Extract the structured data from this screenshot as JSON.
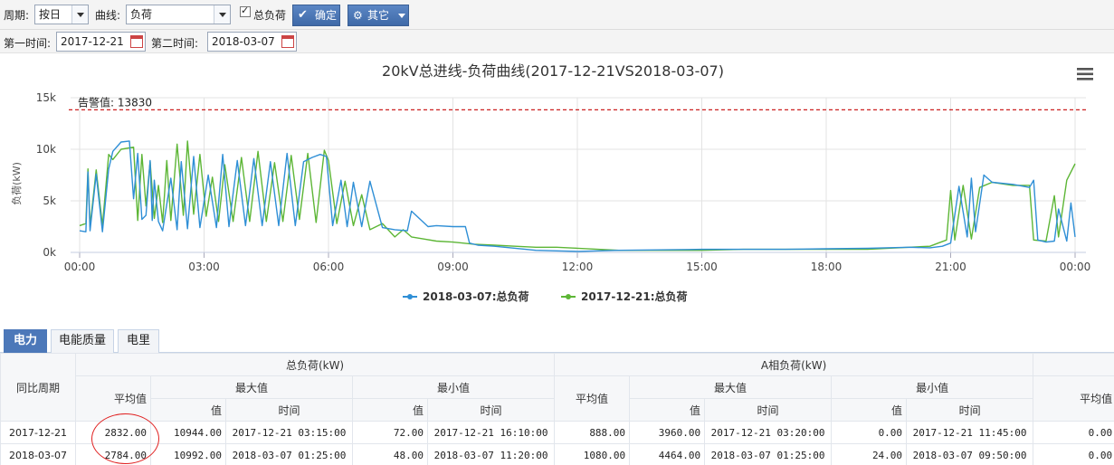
{
  "toolbar": {
    "period_label": "周期:",
    "period_value": "按日",
    "curve_label": "曲线:",
    "curve_value": "负荷",
    "total_load_checkbox": "总负荷",
    "confirm_button": "确定",
    "other_button": "其它",
    "first_time_label": "第一时间:",
    "first_time_value": "2017-12-21",
    "second_time_label": "第二时间:",
    "second_time_value": "2018-03-07"
  },
  "chart_data": {
    "type": "line",
    "title": "20kV总进线-负荷曲线(2017-12-21VS2018-03-07)",
    "ylabel": "负荷(kW)",
    "x_unit": "hour",
    "xlim": [
      0,
      24
    ],
    "ylim": [
      0,
      15000
    ],
    "x_ticks": [
      "00:00",
      "03:00",
      "06:00",
      "09:00",
      "12:00",
      "15:00",
      "18:00",
      "21:00",
      "00:00"
    ],
    "y_ticks": [
      "0k",
      "5k",
      "10k",
      "15k"
    ],
    "alarm": {
      "label": "告警值: 13830",
      "value": 13830,
      "color": "#cc2020"
    },
    "grid": true,
    "legend_position": "bottom",
    "series": [
      {
        "name": "2018-03-07:总负荷",
        "color": "#2f8fd6",
        "x": [
          0,
          0.15,
          0.2,
          0.25,
          0.4,
          0.55,
          0.7,
          0.8,
          1.0,
          1.2,
          1.3,
          1.4,
          1.5,
          1.6,
          1.7,
          1.75,
          1.8,
          1.9,
          2.0,
          2.2,
          2.35,
          2.45,
          2.6,
          2.75,
          2.9,
          3.1,
          3.3,
          3.45,
          3.6,
          3.8,
          4.0,
          4.2,
          4.4,
          4.6,
          4.8,
          5.0,
          5.2,
          5.4,
          5.6,
          5.8,
          5.95,
          6.1,
          6.3,
          6.45,
          6.6,
          6.8,
          7.0,
          7.3,
          7.6,
          7.9,
          8.0,
          8.4,
          8.6,
          9.0,
          9.3,
          9.4,
          9.6,
          10.0,
          10.5,
          11.0,
          11.5,
          12.0,
          12.5,
          13.0,
          14.0,
          15.0,
          16.0,
          17.0,
          18.0,
          19.0,
          20.0,
          20.5,
          20.8,
          21.0,
          21.2,
          21.4,
          21.5,
          21.6,
          21.8,
          22.0,
          22.5,
          22.9,
          23.0,
          23.1,
          23.3,
          23.5,
          23.6,
          23.8,
          23.9,
          24.0
        ],
        "y": [
          2100,
          2000,
          7800,
          2100,
          7600,
          2000,
          8100,
          9800,
          10700,
          10800,
          5200,
          9600,
          3200,
          3600,
          8900,
          3100,
          7000,
          3000,
          2100,
          7200,
          2200,
          8800,
          2300,
          9300,
          2400,
          7500,
          2400,
          9500,
          2500,
          8900,
          2600,
          9100,
          2600,
          8800,
          2600,
          9600,
          2600,
          8800,
          9200,
          9500,
          9300,
          2600,
          7000,
          2500,
          6800,
          2500,
          6900,
          2400,
          2200,
          2100,
          4000,
          2500,
          2600,
          2500,
          2500,
          900,
          700,
          600,
          400,
          200,
          150,
          100,
          150,
          200,
          250,
          300,
          300,
          300,
          350,
          400,
          500,
          450,
          600,
          900,
          6400,
          1500,
          7200,
          2000,
          7500,
          6800,
          6600,
          6300,
          7000,
          1200,
          1000,
          1100,
          4200,
          1100,
          4800,
          1500
        ]
      },
      {
        "name": "2017-12-21:总负荷",
        "color": "#5db636",
        "x": [
          0,
          0.15,
          0.2,
          0.25,
          0.4,
          0.55,
          0.7,
          0.8,
          1.0,
          1.3,
          1.4,
          1.5,
          1.6,
          1.7,
          1.8,
          1.9,
          2.0,
          2.1,
          2.2,
          2.35,
          2.5,
          2.6,
          2.75,
          2.9,
          3.05,
          3.2,
          3.35,
          3.5,
          3.7,
          3.9,
          4.1,
          4.3,
          4.5,
          4.7,
          4.9,
          5.1,
          5.3,
          5.5,
          5.7,
          5.9,
          6.0,
          6.2,
          6.4,
          6.6,
          6.8,
          7.0,
          7.3,
          7.6,
          7.8,
          8.0,
          8.3,
          8.6,
          9.0,
          9.5,
          10.0,
          10.5,
          11.0,
          11.5,
          12.0,
          12.5,
          13.0,
          14.0,
          15.0,
          16.0,
          17.0,
          18.0,
          19.0,
          20.0,
          20.5,
          20.7,
          20.9,
          21.0,
          21.1,
          21.3,
          21.5,
          21.7,
          22.0,
          22.5,
          22.9,
          23.0,
          23.3,
          23.5,
          23.6,
          23.8,
          24.0
        ],
        "y": [
          2600,
          2800,
          8100,
          2500,
          8000,
          2600,
          9500,
          9000,
          10000,
          10200,
          3100,
          9500,
          4500,
          8800,
          3300,
          6500,
          2900,
          8900,
          3100,
          10500,
          3600,
          10800,
          3700,
          9500,
          3500,
          7300,
          3000,
          8500,
          3000,
          9200,
          3000,
          9800,
          3000,
          8700,
          3000,
          9400,
          3200,
          9600,
          2900,
          9900,
          8900,
          2800,
          6900,
          2600,
          5600,
          2200,
          2800,
          1500,
          2200,
          1500,
          1300,
          1100,
          1000,
          800,
          700,
          600,
          500,
          500,
          400,
          300,
          200,
          200,
          200,
          300,
          300,
          300,
          300,
          500,
          600,
          900,
          1200,
          6000,
          1200,
          6500,
          1300,
          6300,
          6800,
          6500,
          6500,
          1200,
          1100,
          5500,
          1500,
          7000,
          8600
        ]
      }
    ]
  },
  "tabs": [
    "电力",
    "电能质量",
    "电里"
  ],
  "table": {
    "col_period": "同比周期",
    "group_total": "总负荷(kW)",
    "group_phaseA": "A相负荷(kW)",
    "avg": "平均值",
    "max": "最大值",
    "min": "最小值",
    "val": "值",
    "time": "时间",
    "rows": [
      {
        "period": "2017-12-21",
        "t_avg": "2832.00",
        "t_max_v": "10944.00",
        "t_max_t": "2017-12-21 03:15:00",
        "t_min_v": "72.00",
        "t_min_t": "2017-12-21 16:10:00",
        "a_avg": "888.00",
        "a_max_v": "3960.00",
        "a_max_t": "2017-12-21 03:20:00",
        "a_min_v": "0.00",
        "a_min_t": "2017-12-21 11:45:00",
        "b_avg": "0.00"
      },
      {
        "period": "2018-03-07",
        "t_avg": "2784.00",
        "t_max_v": "10992.00",
        "t_max_t": "2018-03-07 01:25:00",
        "t_min_v": "48.00",
        "t_min_t": "2018-03-07 11:20:00",
        "a_avg": "1080.00",
        "a_max_v": "4464.00",
        "a_max_t": "2018-03-07 01:25:00",
        "a_min_v": "24.00",
        "a_min_t": "2018-03-07 09:50:00",
        "b_avg": "0.00"
      }
    ]
  }
}
